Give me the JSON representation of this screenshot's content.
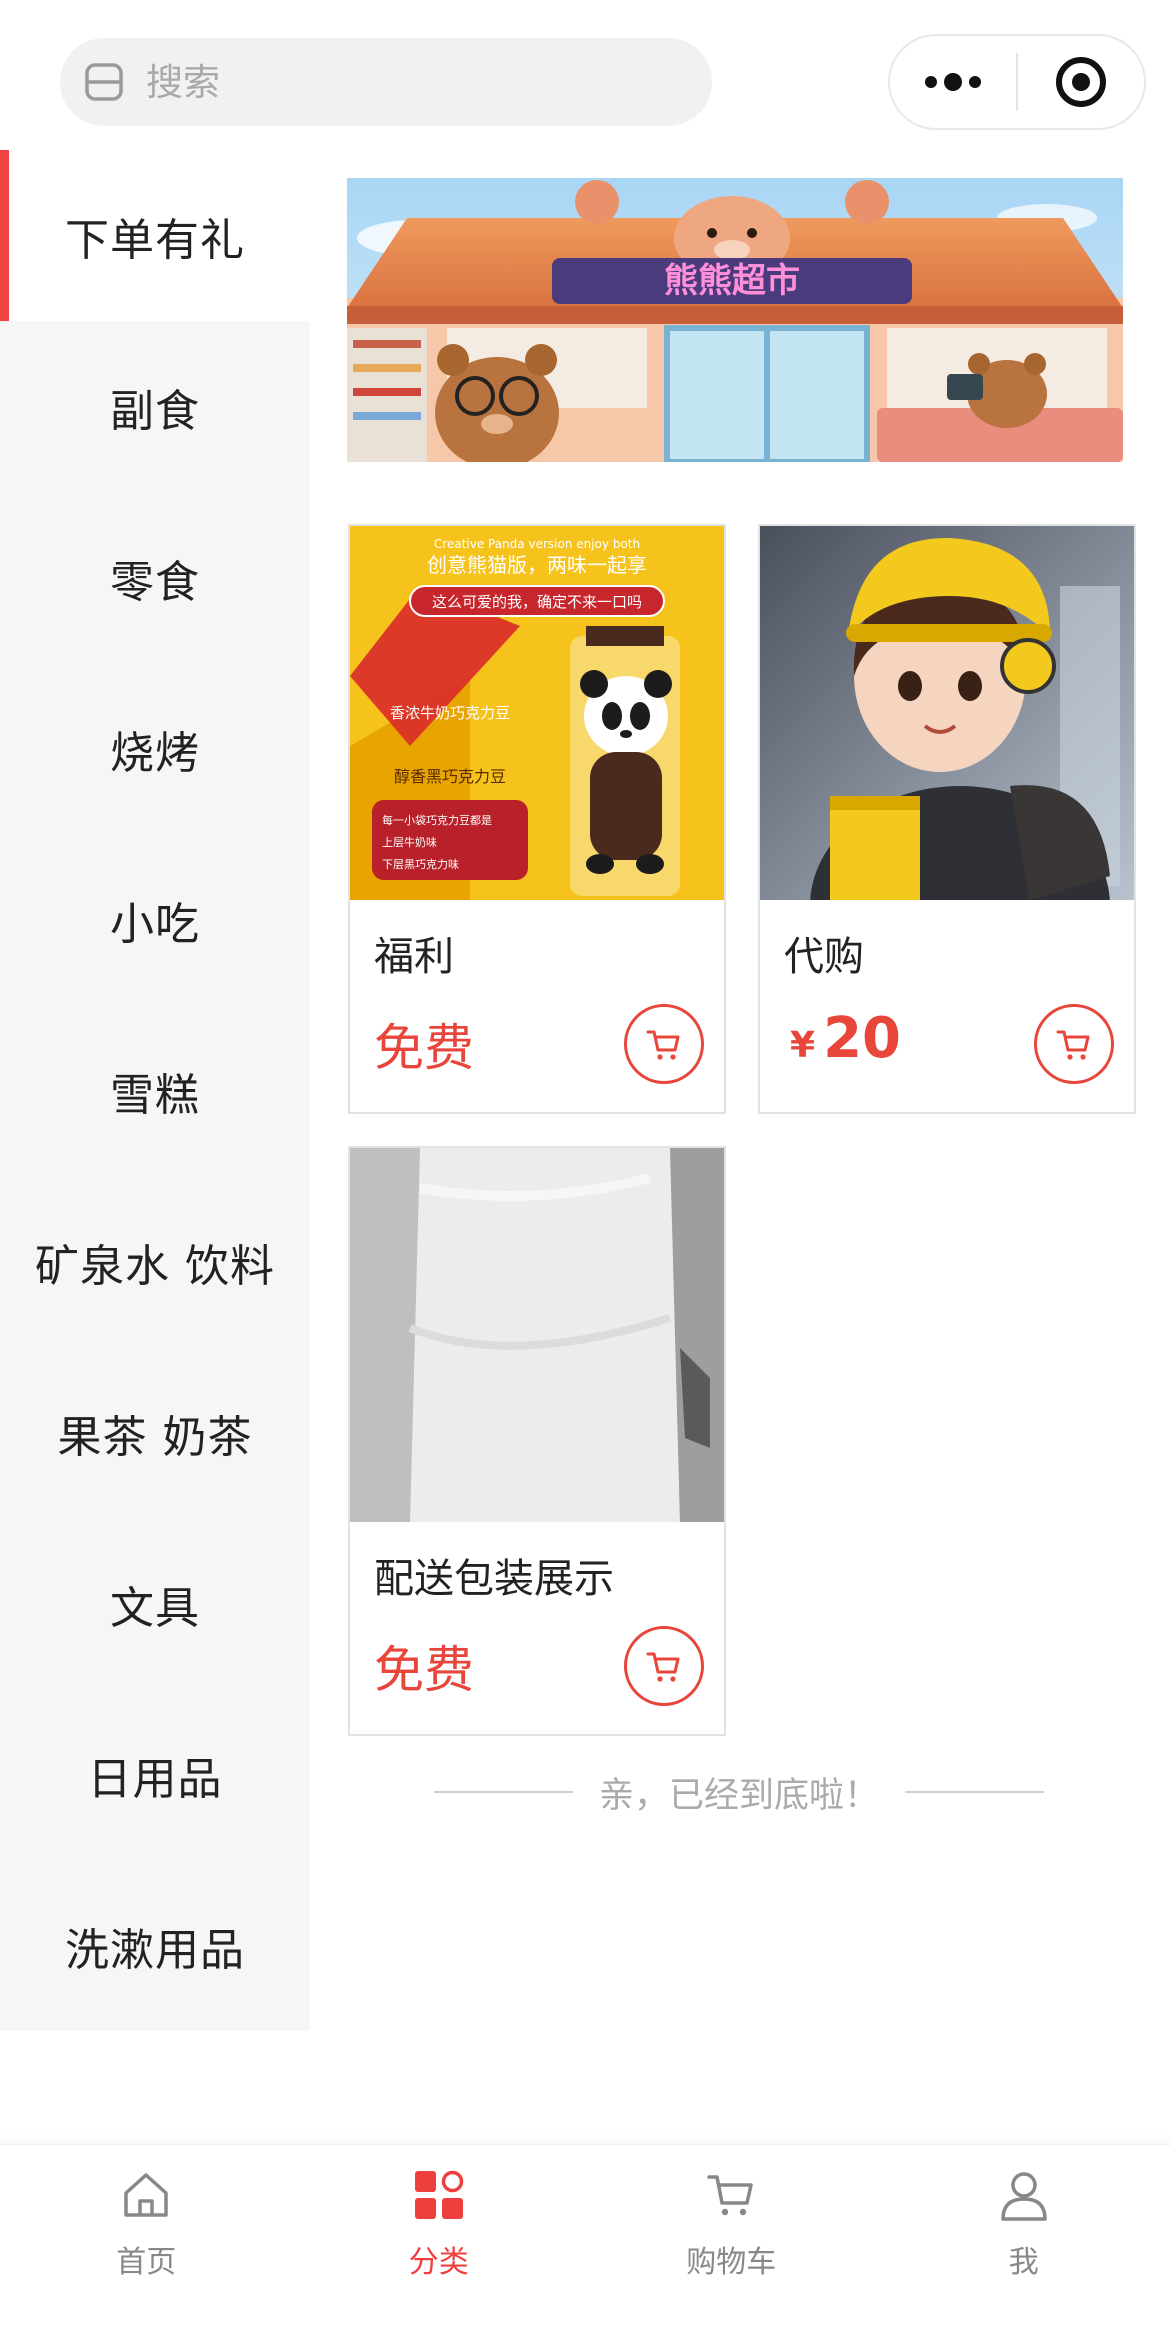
{
  "search": {
    "placeholder": "搜索"
  },
  "sidebar": {
    "items": [
      {
        "label": "下单有礼",
        "active": true
      },
      {
        "label": "副食"
      },
      {
        "label": "零食"
      },
      {
        "label": "烧烤"
      },
      {
        "label": "小吃"
      },
      {
        "label": "雪糕"
      },
      {
        "label": "矿泉水 饮料"
      },
      {
        "label": "果茶 奶茶"
      },
      {
        "label": "文具"
      },
      {
        "label": "日用品"
      },
      {
        "label": "洗漱用品"
      }
    ]
  },
  "banner": {
    "sign_text": "熊熊超市"
  },
  "products": [
    {
      "name": "福利",
      "price_text": "免费",
      "thumb_lines": [
        "Creative Panda version  enjoy both",
        "创意熊猫版，两味一起享",
        "这么可爱的我，确定不来一口吗",
        "香浓牛奶巧克力豆",
        "醇香黑巧克力豆",
        "每一小袋巧克力豆都是",
        "上层牛奶味",
        "下层黑巧克力味"
      ]
    },
    {
      "name": "代购",
      "currency": "¥",
      "price": "20"
    },
    {
      "name": "配送包装展示",
      "price_text": "免费"
    }
  ],
  "end_note": "亲，已经到底啦！",
  "tabbar": {
    "tabs": [
      {
        "label": "首页",
        "icon": "home-icon"
      },
      {
        "label": "分类",
        "icon": "category-icon",
        "active": true
      },
      {
        "label": "购物车",
        "icon": "cart-icon"
      },
      {
        "label": "我",
        "icon": "user-icon"
      }
    ]
  },
  "colors": {
    "accent": "#e8453b",
    "sidebar_bg": "#f6f6f6",
    "active_bar": "#f04444"
  }
}
